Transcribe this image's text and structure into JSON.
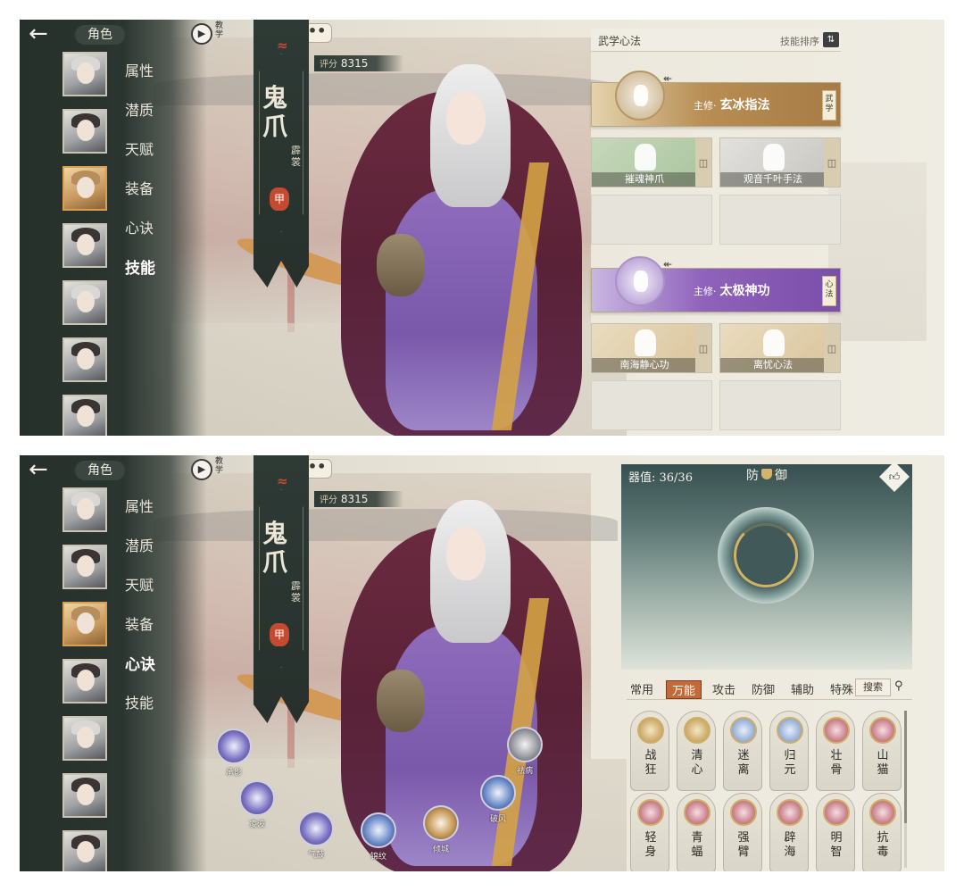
{
  "top": {
    "header": {
      "back_icon": "back-arrow-icon",
      "title": "角色",
      "teach_label": "教学",
      "chat_label": "•••"
    },
    "sidebar_menu": [
      "属性",
      "潜质",
      "天赋",
      "装备",
      "心诀",
      "技能"
    ],
    "active_menu": "技能",
    "banner": {
      "name": "鬼爪",
      "subtitle": "霹裳",
      "badge": "甲",
      "score_label": "评分",
      "score": "8315"
    },
    "skills_panel": {
      "title": "武学心法",
      "sort_label": "技能排序",
      "martial": {
        "main_label": "主修·",
        "main_name": "玄冰指法",
        "tag": "武学",
        "subs": [
          "摧魂神爪",
          "观音千叶手法"
        ]
      },
      "inner": {
        "main_label": "主修·",
        "main_name": "太极神功",
        "tag": "心法",
        "subs": [
          "南海静心功",
          "离忧心法"
        ]
      }
    }
  },
  "bottom": {
    "header": {
      "back_icon": "back-arrow-icon",
      "title": "角色",
      "teach_label": "教学",
      "chat_label": "•••"
    },
    "sidebar_menu": [
      "属性",
      "潜质",
      "天赋",
      "装备",
      "心诀",
      "技能"
    ],
    "active_menu": "心诀",
    "banner": {
      "name": "鬼爪",
      "subtitle": "霹裳",
      "badge": "甲",
      "score_label": "评分",
      "score": "8315"
    },
    "loadout": {
      "capacity": "器值: 36/36",
      "defense_label_1": "防",
      "defense_label_2": "御",
      "like_icon": "thumbs-up-icon",
      "tabs": [
        "常用",
        "万能",
        "攻击",
        "防御",
        "辅助",
        "特殊"
      ],
      "active_tab": "万能",
      "search_label": "搜索",
      "slots": [
        {
          "name": "战狂",
          "color": "gold"
        },
        {
          "name": "清心",
          "color": "gold"
        },
        {
          "name": "迷离",
          "color": "blue"
        },
        {
          "name": "归元",
          "color": "blue"
        },
        {
          "name": "壮骨",
          "color": "red"
        },
        {
          "name": "山猫",
          "color": "red"
        },
        {
          "name": "轻身",
          "color": "red"
        },
        {
          "name": "青蝠",
          "color": "red"
        },
        {
          "name": "强臂",
          "color": "red"
        },
        {
          "name": "辟海",
          "color": "red"
        },
        {
          "name": "明智",
          "color": "red"
        },
        {
          "name": "抗毒",
          "color": "red"
        }
      ]
    },
    "orbs": [
      {
        "label": "承影",
        "color": "purple"
      },
      {
        "label": "凌波",
        "color": "purple"
      },
      {
        "label": "气鼓",
        "color": "purple"
      },
      {
        "label": "锦纹",
        "color": "blue"
      },
      {
        "label": "倾城",
        "color": "gold"
      },
      {
        "label": "破风",
        "color": "blue"
      },
      {
        "label": "祛病",
        "color": "grey"
      }
    ]
  }
}
